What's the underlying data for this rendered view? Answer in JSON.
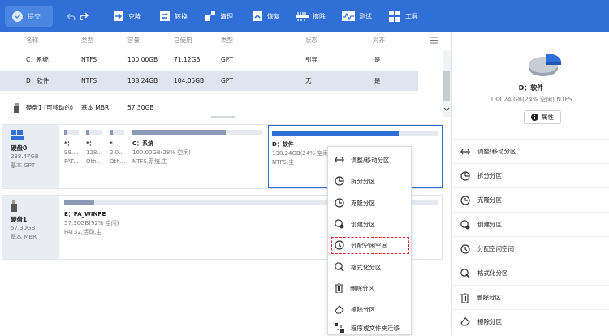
{
  "toolbar": {
    "commit": "提交",
    "items": [
      {
        "label": "克隆",
        "icon": "clone-icon"
      },
      {
        "label": "转换",
        "icon": "convert-icon"
      },
      {
        "label": "清理",
        "icon": "cleanup-icon"
      },
      {
        "label": "恢复",
        "icon": "recover-icon"
      },
      {
        "label": "擦除",
        "icon": "wipe-icon"
      },
      {
        "label": "测试",
        "icon": "test-icon"
      },
      {
        "label": "工具",
        "icon": "tools-icon"
      }
    ]
  },
  "table": {
    "headers": [
      "名称",
      "类型",
      "容量",
      "已使用",
      "类型",
      "状态",
      "对齐"
    ],
    "rows": [
      [
        "C：系统",
        "NTFS",
        "100.00GB",
        "71.12GB",
        "GPT",
        "引导",
        "是"
      ],
      [
        "D：软件",
        "NTFS",
        "138.24GB",
        "104.05GB",
        "GPT",
        "无",
        "是"
      ]
    ],
    "disk_row": {
      "name": "硬盘1 (可移动的)",
      "type": "基本 MBR",
      "size": "57.30GB"
    }
  },
  "disks": [
    {
      "name": "硬盘0",
      "size": "238.47GB",
      "style": "基本 GPT",
      "partitions": [
        {
          "label": "*：",
          "l2": "99....",
          "l3": "FAT...",
          "used": 0.2
        },
        {
          "label": "*：",
          "l2": "128...",
          "l3": "Oth...",
          "used": 0.2
        },
        {
          "label": "*：",
          "l2": "2.0...",
          "l3": "Oth...",
          "used": 0.2
        },
        {
          "label": "C：系统",
          "l2": "100.00GB(28% 空闲)",
          "l3": "NTFS,系统,主",
          "used": 0.72
        },
        {
          "label": "D：软件",
          "l2": "138.24GB(24% 空闲)",
          "l3": "NTFS,主",
          "used": 0.76
        }
      ]
    },
    {
      "name": "硬盘1",
      "size": "57.30GB",
      "style": "基本 MBR",
      "partitions": [
        {
          "label": "E：PA_WINPE",
          "l2": "57.30GB(92% 空闲)",
          "l3": "FAT32,活动,主",
          "used": 0.08
        }
      ]
    }
  ],
  "context_menu": [
    {
      "label": "调整/移动分区",
      "icon": "resize-icon"
    },
    {
      "label": "拆分分区",
      "icon": "split-icon"
    },
    {
      "label": "克隆分区",
      "icon": "clone-partition-icon"
    },
    {
      "label": "创建分区",
      "icon": "create-partition-icon"
    },
    {
      "label": "分配空闲空间",
      "icon": "allocate-space-icon"
    },
    {
      "label": "格式化分区",
      "icon": "format-icon"
    },
    {
      "label": "删除分区",
      "icon": "delete-icon"
    },
    {
      "label": "擦除分区",
      "icon": "erase-icon"
    },
    {
      "label": "程序或文件夹迁移",
      "icon": "migrate-icon"
    }
  ],
  "sidebar": {
    "name": "D：软件",
    "detail": "138.24 GB(24% 空闲),NTFS",
    "props": "属性",
    "used_fraction": 0.76,
    "actions": [
      "调整/移动分区",
      "拆分分区",
      "克隆分区",
      "创建分区",
      "分配空闲空间",
      "格式化分区",
      "删除分区",
      "擦除分区"
    ]
  },
  "colors": {
    "accent": "#2f6fd6",
    "highlight": "#e8232b"
  }
}
